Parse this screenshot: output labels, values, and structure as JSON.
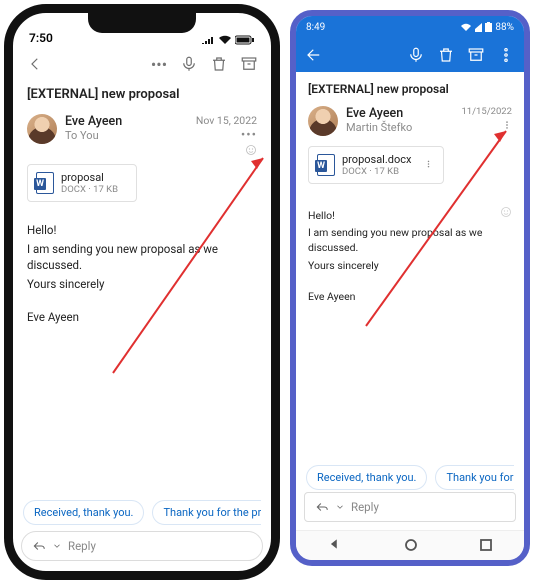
{
  "iphone": {
    "status": {
      "time": "7:50"
    },
    "subject": "[EXTERNAL] new proposal",
    "sender": {
      "name": "Eve Ayeen",
      "to": "To You",
      "date": "Nov 15, 2022"
    },
    "attachment": {
      "name": "proposal",
      "meta": "DOCX · 17 KB"
    },
    "body": {
      "line1": "Hello!",
      "line2": "I am sending you new proposal as we discussed.",
      "line3": "Yours sincerely",
      "sig": "Eve Ayeen"
    },
    "quick": {
      "q1": "Received, thank you.",
      "q2": "Thank you for the proposal."
    },
    "reply": "Reply"
  },
  "android": {
    "status": {
      "time": "8:49",
      "battery": "88%"
    },
    "subject": "[EXTERNAL] new proposal",
    "sender": {
      "name": "Eve Ayeen",
      "to": "Martin Štefko",
      "date": "11/15/2022"
    },
    "attachment": {
      "name": "proposal.docx",
      "meta": "DOCX · 17 KB"
    },
    "body": {
      "line1": "Hello!",
      "line2": "I am sending you new proposal as we discussed.",
      "line3": "Yours sincerely",
      "sig": "Eve Ayeen"
    },
    "quick": {
      "q1": "Received, thank you.",
      "q2": "Thank you for the proposal."
    },
    "reply": "Reply"
  },
  "icons": {
    "back": "back-icon",
    "more": "more-icon",
    "mic": "mic-icon",
    "trash": "trash-icon",
    "archive": "archive-icon",
    "overflow": "overflow-icon",
    "reply": "reply-icon",
    "chevron": "chevron-down-icon"
  }
}
